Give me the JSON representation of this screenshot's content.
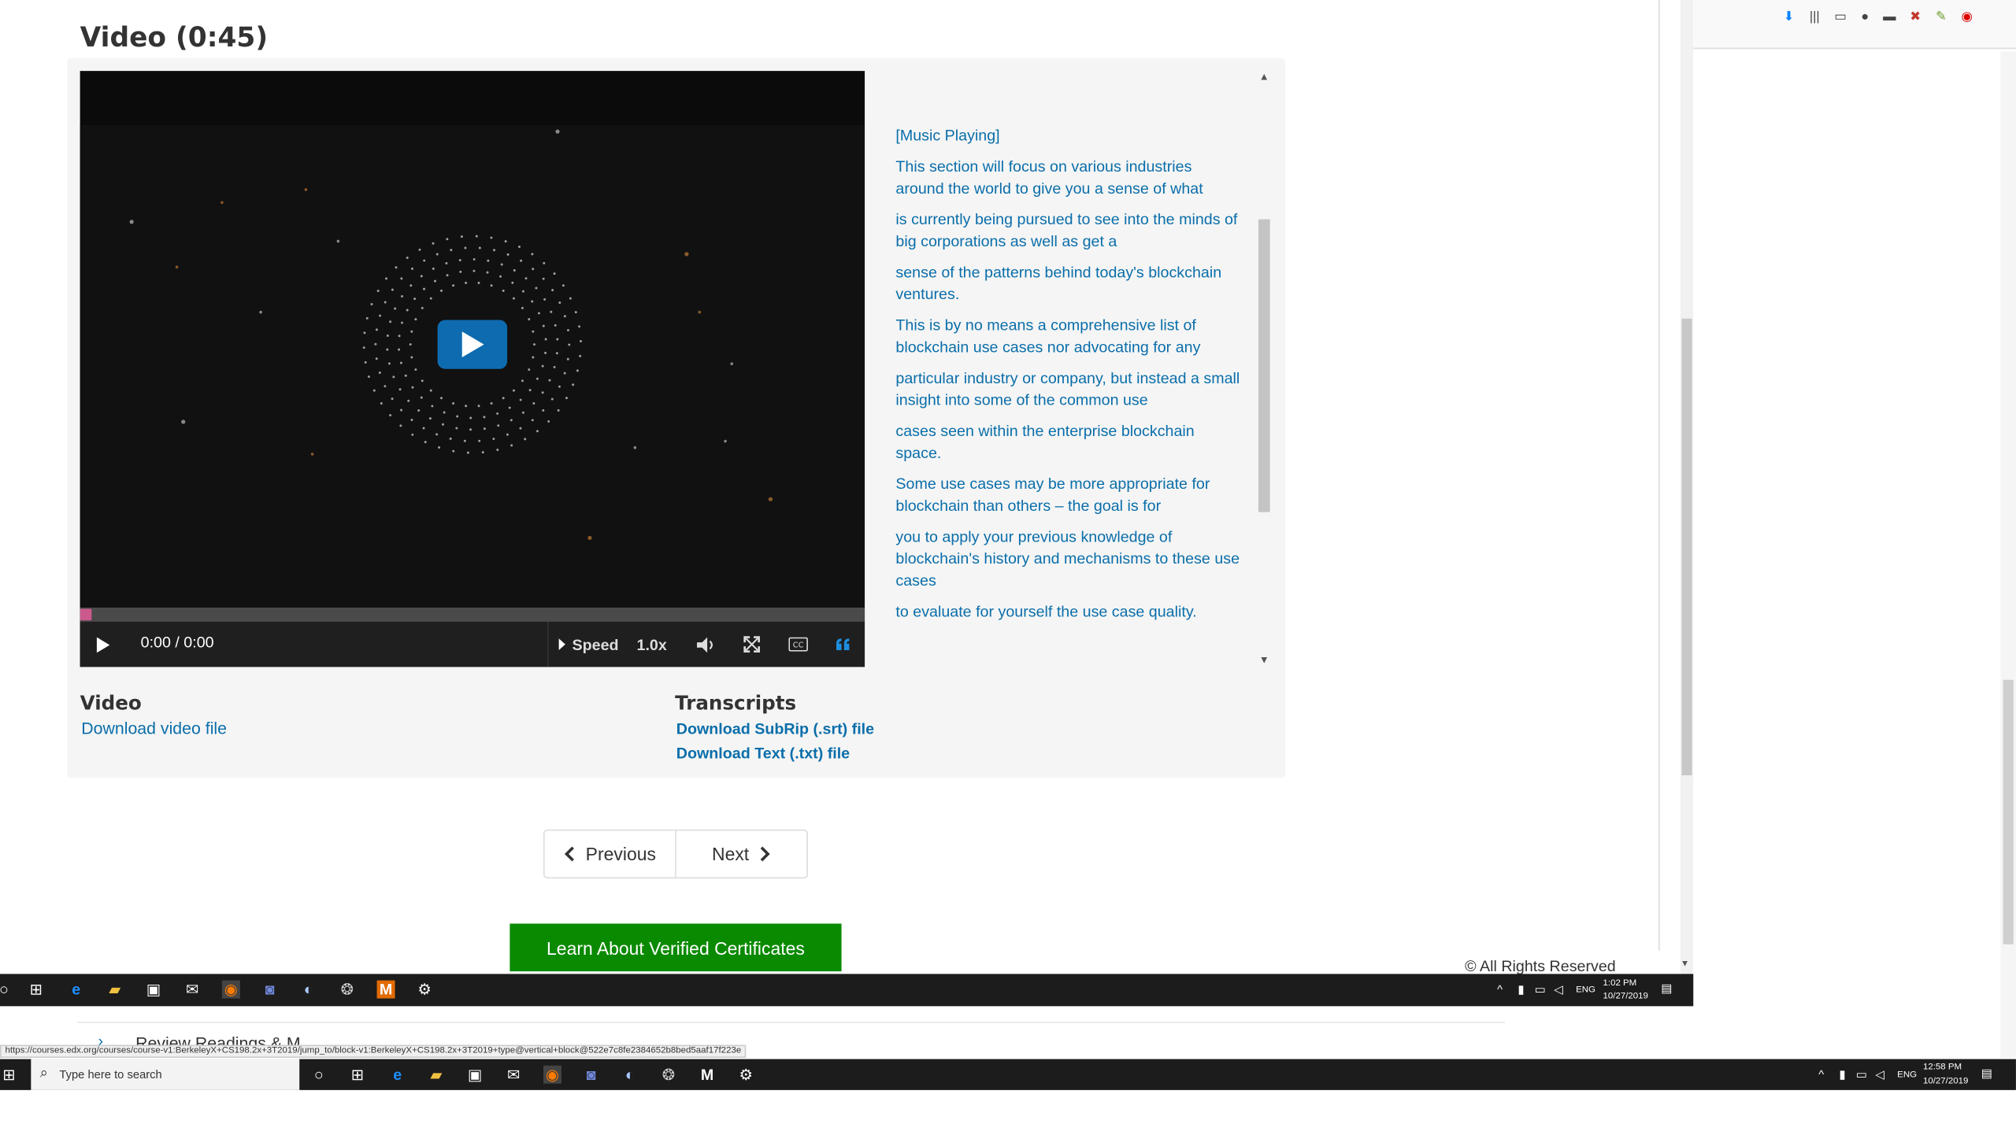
{
  "video": {
    "title": "Video (0:45)",
    "time": "0:00 / 0:00",
    "speed_label": "Speed",
    "speed_value": "1.0x",
    "progress": 0
  },
  "transcript": [
    "[Music Playing]",
    "This section will focus on various industries around the world to give you a sense of what",
    "is currently being pursued to see into the minds of big corporations as well as get a",
    "sense of the patterns behind today's blockchain ventures.",
    "This is by no means a comprehensive list of blockchain use cases nor advocating for any",
    "particular industry or company, but instead a small insight into some of the common use",
    "cases seen within the enterprise blockchain space.",
    "Some use cases may be more appropriate for blockchain than others – the goal is for",
    "you to apply your previous knowledge of blockchain's history and mechanisms to these use cases",
    "to evaluate for yourself the use case quality."
  ],
  "downloads": {
    "video_heading": "Video",
    "video_link": "Download video file",
    "transcripts_heading": "Transcripts",
    "srt_link": "Download SubRip (.srt) file",
    "txt_link": "Download Text (.txt) file"
  },
  "nav": {
    "previous": "Previous",
    "next": "Next"
  },
  "verify_button": "Learn About Verified Certificates",
  "copyright": "© All Rights Reserved",
  "under_text": "Review Readings & M...",
  "status_url": "https://courses.edx.org/courses/course-v1:BerkeleyX+CS198.2x+3T2019/jump_to/block-v1:BerkeleyX+CS198.2x+3T2019+type@vertical+block@522e7c8fe2384652b8bed5aaf17f223e",
  "taskbar_inner": {
    "lang": "ENG",
    "time": "1:02 PM",
    "date": "10/27/2019"
  },
  "taskbar_outer": {
    "search_placeholder": "Type here to search",
    "lang": "ENG",
    "time": "12:58 PM",
    "date": "10/27/2019"
  },
  "colors": {
    "link": "#0a6eaa",
    "play_button": "#0e6bb0",
    "verify_green": "#0a8a00",
    "progress_handle": "#cb598d"
  }
}
